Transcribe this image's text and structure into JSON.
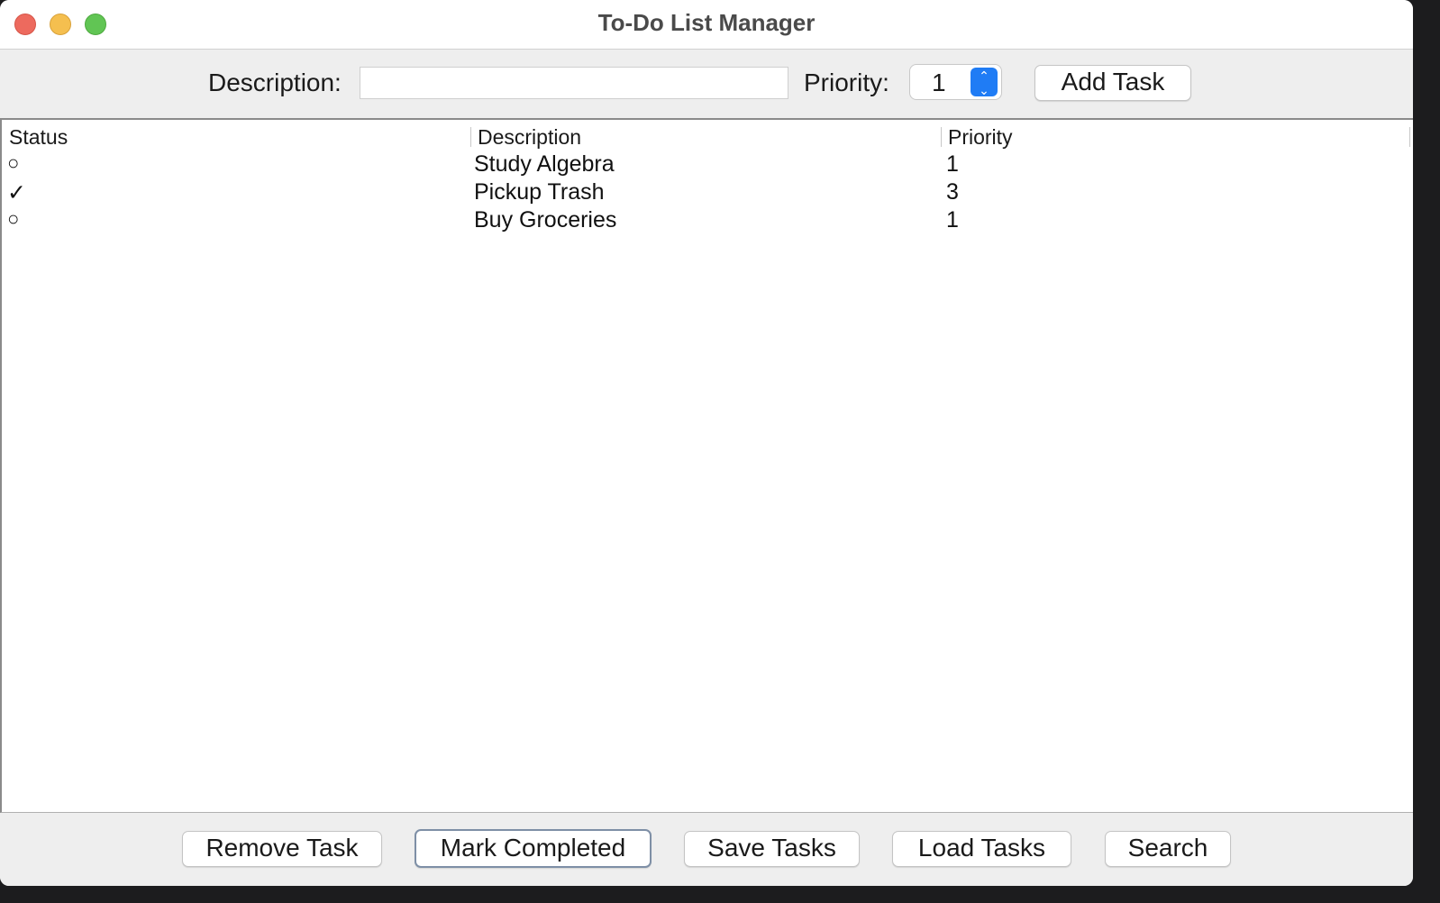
{
  "window": {
    "title": "To-Do List Manager"
  },
  "toolbar": {
    "description_label": "Description:",
    "description_value": "",
    "priority_label": "Priority:",
    "priority_value": "1",
    "add_task_label": "Add Task"
  },
  "table": {
    "columns": [
      "Status",
      "Description",
      "Priority"
    ],
    "rows": [
      {
        "status": "○",
        "description": "Study Algebra",
        "priority": "1"
      },
      {
        "status": "✓",
        "description": "Pickup Trash",
        "priority": "3"
      },
      {
        "status": "○",
        "description": "Buy Groceries",
        "priority": "1"
      }
    ]
  },
  "actions": {
    "remove_task": "Remove Task",
    "mark_completed": "Mark Completed",
    "save_tasks": "Save Tasks",
    "load_tasks": "Load Tasks",
    "search": "Search"
  },
  "icons": {
    "close": "close-icon",
    "minimize": "minimize-icon",
    "maximize": "maximize-icon",
    "spinner": "stepper-arrows-icon"
  },
  "colors": {
    "close": "#ed6a5e",
    "minimize": "#f5bf4f",
    "maximize": "#61c554",
    "accent": "#1f7cf5"
  }
}
